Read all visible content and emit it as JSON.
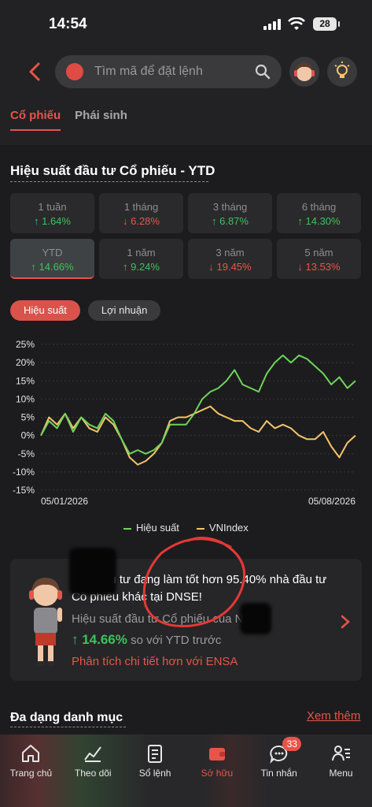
{
  "status": {
    "time": "14:54",
    "battery": "28"
  },
  "header": {
    "search_placeholder": "Tìm mã để đặt lệnh",
    "tabs": [
      {
        "label": "Cổ phiếu",
        "active": true
      },
      {
        "label": "Phái sinh",
        "active": false
      }
    ]
  },
  "performance": {
    "title": "Hiệu suất đầu tư Cổ phiếu - YTD",
    "periods": [
      {
        "label": "1 tuần",
        "value": "↑ 1.64%",
        "dir": "up"
      },
      {
        "label": "1 tháng",
        "value": "↓ 6.28%",
        "dir": "down"
      },
      {
        "label": "3 tháng",
        "value": "↑ 6.87%",
        "dir": "up"
      },
      {
        "label": "6 tháng",
        "value": "↑ 14.30%",
        "dir": "up"
      },
      {
        "label": "YTD",
        "value": "↑ 14.66%",
        "dir": "up",
        "active": true
      },
      {
        "label": "1 năm",
        "value": "↑ 9.24%",
        "dir": "up"
      },
      {
        "label": "3 năm",
        "value": "↓ 19.45%",
        "dir": "down"
      },
      {
        "label": "5 năm",
        "value": "↓ 13.53%",
        "dir": "down"
      }
    ],
    "toggles": [
      {
        "label": "Hiệu suất",
        "active": true
      },
      {
        "label": "Lợi nhuận",
        "active": false
      }
    ]
  },
  "chart_data": {
    "type": "line",
    "x_start_label": "05/01/2026",
    "x_end_label": "05/08/2026",
    "ylim": [
      -15,
      25
    ],
    "yticks": [
      "25%",
      "20%",
      "15%",
      "10%",
      "5%",
      "0%",
      "-5%",
      "-10%",
      "-15%"
    ],
    "grid": true,
    "legend_position": "bottom",
    "series": [
      {
        "name": "Hiệu suất",
        "color": "#6fd35a",
        "values": [
          0,
          4,
          2,
          6,
          1,
          5,
          3,
          2,
          6,
          4,
          -1,
          -5,
          -4,
          -5,
          -4,
          -2,
          3,
          3,
          3,
          6,
          10,
          12,
          13,
          15,
          18,
          14,
          13,
          12,
          17,
          20,
          22,
          20,
          22,
          21,
          19,
          17,
          14,
          16,
          13,
          15
        ]
      },
      {
        "name": "VNIndex",
        "color": "#f5c46a",
        "values": [
          0,
          5,
          3,
          6,
          2,
          5,
          2,
          1,
          5,
          3,
          -1,
          -6,
          -8,
          -7,
          -5,
          -2,
          4,
          5,
          5,
          6,
          7,
          8,
          6,
          5,
          4,
          4,
          2,
          1,
          4,
          2,
          3,
          2,
          0,
          -1,
          -1,
          1,
          -3,
          -6,
          -2,
          0
        ]
      }
    ]
  },
  "promo": {
    "line1": "Nhà đầu tư đang làm tốt hơn 95.40% nhà đầu tư Cổ phiếu khác tại DNSE!",
    "line2": "Hiệu suất đầu tư Cổ phiếu của Nam",
    "value": "↑ 14.66%",
    "line3_suffix": "so với YTD trước",
    "link": "Phân tích chi tiết hơn với ENSA"
  },
  "diversify": {
    "title": "Đa dạng danh mục",
    "more": "Xem thêm"
  },
  "nav": [
    {
      "label": "Trang chủ",
      "icon": "home-icon"
    },
    {
      "label": "Theo dõi",
      "icon": "chart-icon"
    },
    {
      "label": "Sổ lệnh",
      "icon": "order-book-icon"
    },
    {
      "label": "Sở hữu",
      "icon": "wallet-icon",
      "active": true
    },
    {
      "label": "Tin nhắn",
      "icon": "message-icon",
      "badge": "33"
    },
    {
      "label": "Menu",
      "icon": "menu-icon"
    }
  ]
}
